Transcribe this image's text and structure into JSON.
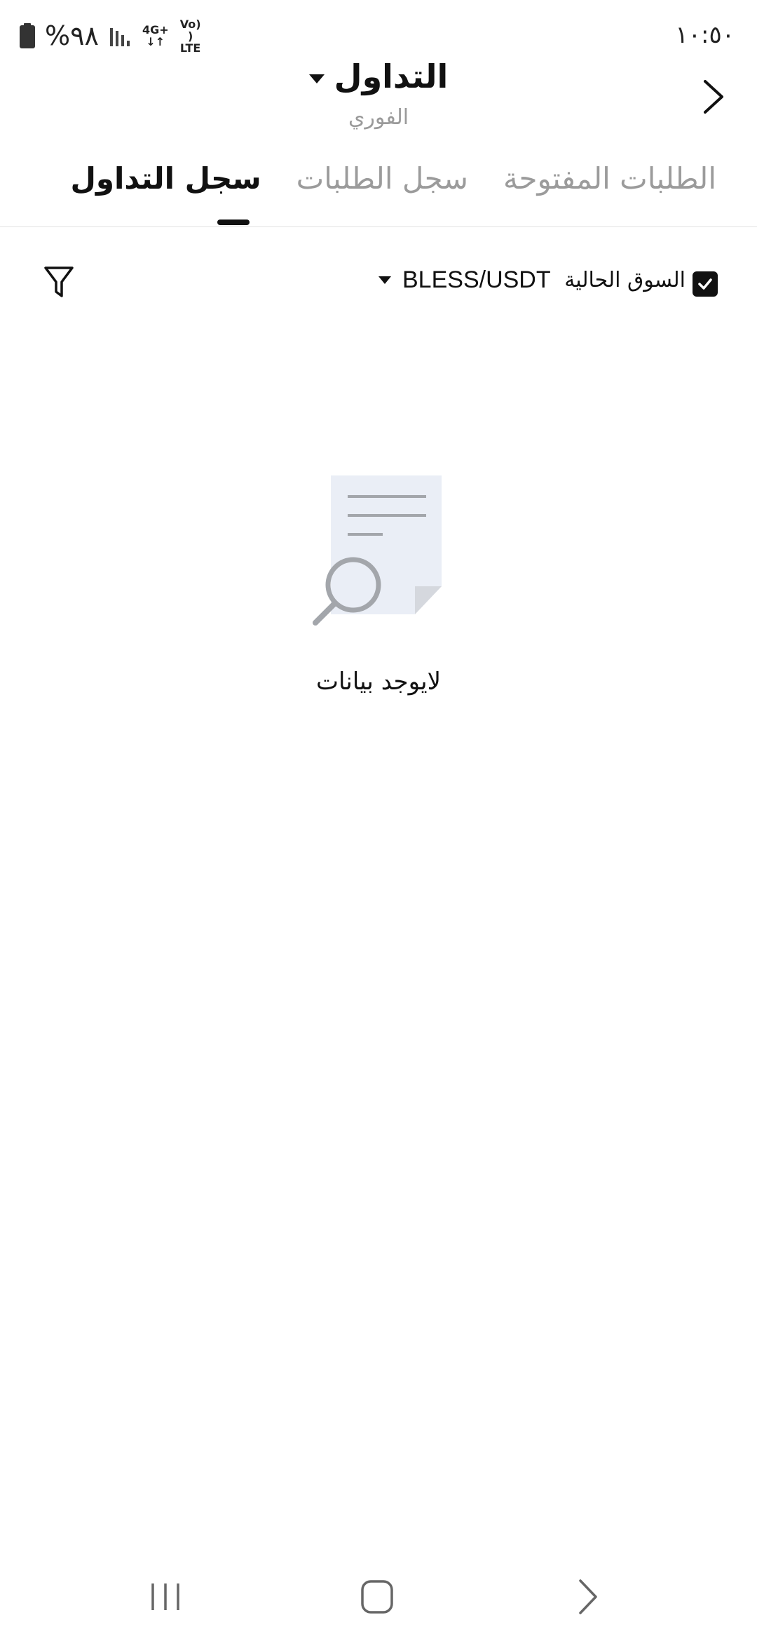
{
  "status_bar": {
    "battery": "%٩٨",
    "network": "4G+",
    "volte": "Vo)) LTE",
    "time": "١٠:٥٠"
  },
  "header": {
    "title": "التداول",
    "subtitle": "الفوري"
  },
  "tabs": [
    {
      "label": "الطلبات المفتوحة",
      "active": false
    },
    {
      "label": "سجل الطلبات",
      "active": false
    },
    {
      "label": "سجل التداول",
      "active": true
    }
  ],
  "filter": {
    "current_market_label": "السوق الحالية",
    "current_market_checked": true,
    "pair": "BLESS/USDT"
  },
  "empty_state": {
    "text": "لايوجد بيانات"
  },
  "icons": {
    "back": "chevron-right-icon",
    "filter": "funnel-icon",
    "recents": "recents-icon",
    "home": "home-icon",
    "nav_back": "nav-back-icon"
  },
  "colors": {
    "text_primary": "#111111",
    "text_secondary": "#9b9b9b",
    "illustration_doc": "#eaeef6",
    "illustration_gray": "#a3a6ab"
  }
}
